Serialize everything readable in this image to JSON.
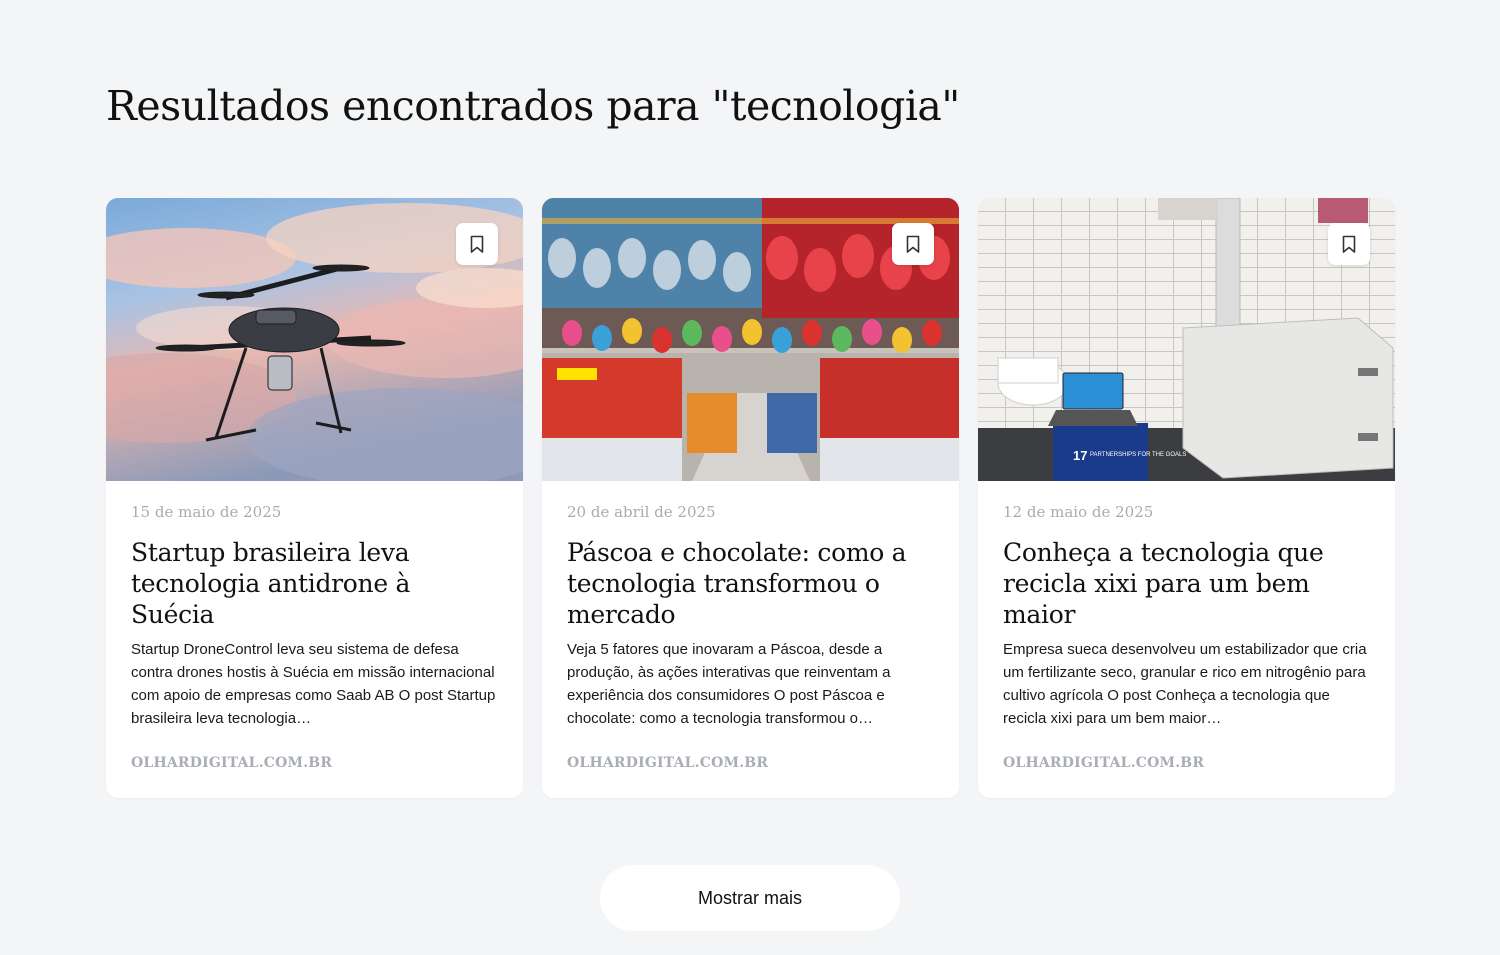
{
  "page": {
    "title": "Resultados encontrados para \"tecnologia\""
  },
  "cards": [
    {
      "date": "15 de maio de 2025",
      "title": "Startup brasileira leva tecnologia antidrone à Suécia",
      "summary": "Startup DroneControl leva seu sistema de defesa contra drones hostis à Suécia em missão internacional com apoio de empresas como Saab AB O post Startup brasileira leva tecnologia…",
      "source": "OLHARDIGITAL.COM.BR",
      "image_subject": "drone flying in sunset sky"
    },
    {
      "date": "20 de abril de 2025",
      "title": "Páscoa e chocolate: como a tecnologia transformou o mercado",
      "summary": "Veja 5 fatores que inovaram a Páscoa, desde a produção, às ações interativas que reinventam a experiência dos consumidores O post Páscoa e chocolate: como a tecnologia transformou o…",
      "source": "OLHARDIGITAL.COM.BR",
      "image_subject": "supermarket aisle with hanging easter eggs"
    },
    {
      "date": "12 de maio de 2025",
      "title": "Conheça a tecnologia que recicla xixi para um bem maior",
      "summary": "Empresa sueca desenvolveu um estabilizador que cria um fertilizante seco, granular e rico em nitrogênio para cultivo agrícola O post Conheça a tecnologia que recicla xixi para um bem maior…",
      "source": "OLHARDIGITAL.COM.BR",
      "image_subject": "bathroom with urine recycling machine and laptop",
      "image_text": [
        "PARTNERSHIPS FOR THE GOALS",
        "17"
      ]
    }
  ],
  "more_button": {
    "label": "Mostrar mais"
  },
  "icons": {
    "bookmark": "bookmark-icon"
  },
  "colors": {
    "background": "#f4f5f7",
    "card": "#ffffff",
    "meta_text": "#a7acb3"
  }
}
